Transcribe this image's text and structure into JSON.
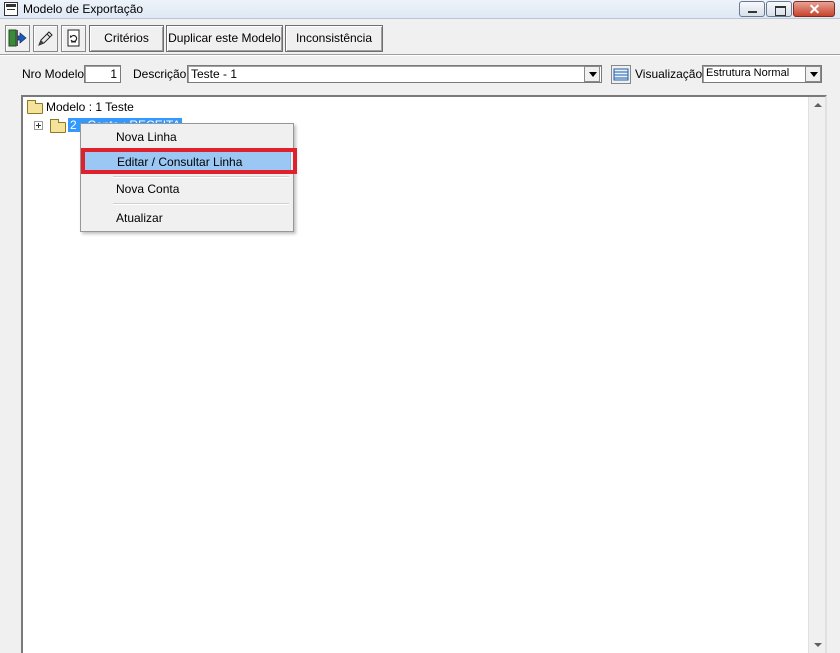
{
  "window": {
    "title": "Modelo de Exportação"
  },
  "toolbar": {
    "criterios_label": "Critérios",
    "duplicar_label": "Duplicar este Modelo",
    "inconsistencia_label": "Inconsistência"
  },
  "form": {
    "nro_modelo_label": "Nro Modelo",
    "nro_modelo_value": "1",
    "descricao_label": "Descrição",
    "descricao_value": "Teste - 1",
    "visualizacao_label": "Visualização",
    "visualizacao_value": "Estrutura Normal"
  },
  "tree": {
    "root_label": "Modelo : 1 Teste",
    "child_label": "2 - Conta : RECEITA"
  },
  "context_menu": {
    "items": [
      {
        "label": "Nova Linha"
      },
      {
        "label": "Editar / Consultar Linha"
      },
      {
        "label": "Nova Conta"
      },
      {
        "label": "Atualizar"
      }
    ]
  },
  "colors": {
    "selection": "#3399ff",
    "highlight": "#e0202a",
    "menu_hover": "#9ac7f3"
  }
}
